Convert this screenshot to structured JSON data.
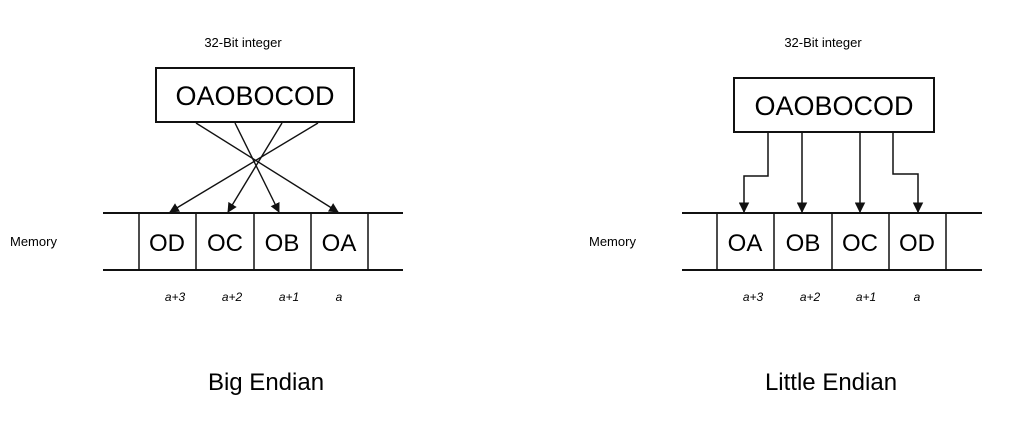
{
  "big_endian": {
    "header": "32-Bit integer",
    "value": "OAOBOCOD",
    "memory_label": "Memory",
    "cells": [
      "OD",
      "OC",
      "OB",
      "OA"
    ],
    "addresses": [
      "a+3",
      "a+2",
      "a+1",
      "a"
    ],
    "caption": "Big Endian"
  },
  "little_endian": {
    "header": "32-Bit integer",
    "value": "OAOBOCOD",
    "memory_label": "Memory",
    "cells": [
      "OA",
      "OB",
      "OC",
      "OD"
    ],
    "addresses": [
      "a+3",
      "a+2",
      "a+1",
      "a"
    ],
    "caption": "Little Endian"
  }
}
